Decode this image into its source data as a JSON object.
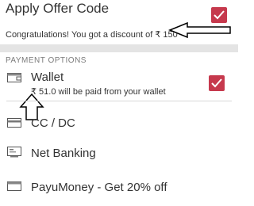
{
  "offer": {
    "title": "Apply Offer Code",
    "message": "Congratulations! You got a discount of ₹ 150",
    "checked": true
  },
  "payment": {
    "section_title": "PAYMENT OPTIONS",
    "options": [
      {
        "label": "Wallet",
        "sublabel": "₹ 51.0 will be paid from your wallet",
        "icon": "wallet-icon",
        "checked": true
      },
      {
        "label": "CC / DC",
        "icon": "card-icon",
        "checked": false
      },
      {
        "label": "Net Banking",
        "icon": "bank-icon",
        "checked": false
      },
      {
        "label": "PayuMoney - Get 20% off",
        "icon": "payumoney-icon",
        "checked": false
      }
    ]
  },
  "colors": {
    "accent": "#c6394d",
    "separator": "#e4e4e4"
  }
}
